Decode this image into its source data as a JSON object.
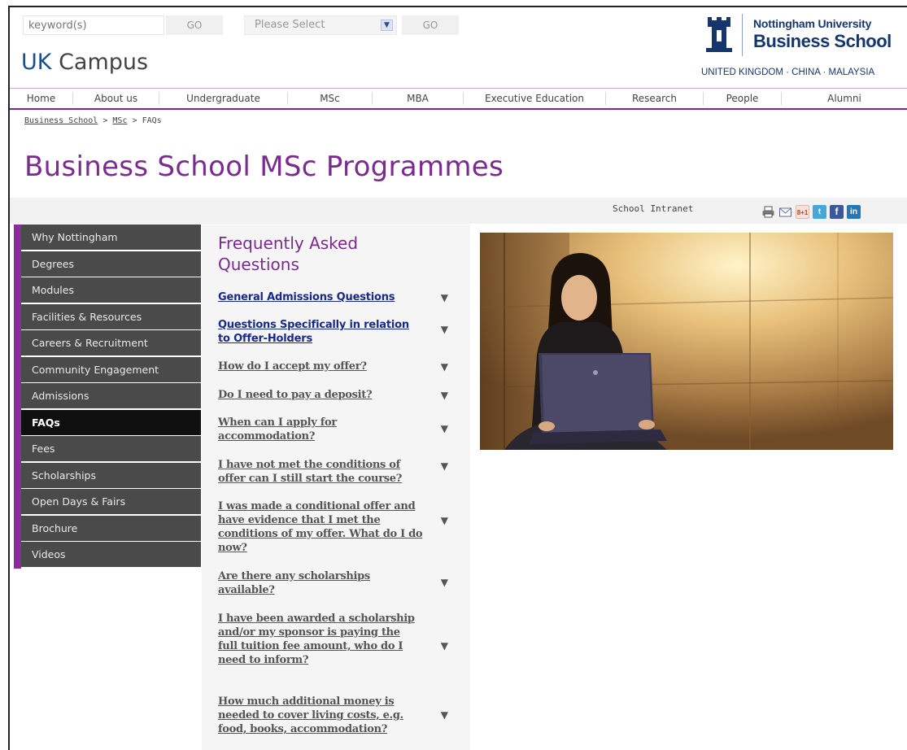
{
  "search": {
    "keyword_placeholder": "keyword(s)",
    "go_label": "GO",
    "select_value": "Please Select",
    "select_go_label": "GO"
  },
  "campus": {
    "prefix": "UK",
    "suffix": "Campus"
  },
  "logo": {
    "line1": "Nottingham University",
    "line2": "Business School",
    "line3": "UNITED KINGDOM · CHINA · MALAYSIA"
  },
  "topnav": [
    "Home",
    "About us",
    "Undergraduate",
    "MSc",
    "MBA",
    "Executive Education",
    "Research",
    "People",
    "Alumni"
  ],
  "breadcrumb": {
    "items": [
      "Business School",
      "MSc",
      "FAQs"
    ],
    "separator": ">"
  },
  "page_title": "Business School MSc Programmes",
  "toolbar": {
    "intranet_label": "School Intranet",
    "share_icons": [
      "print-icon",
      "email-icon",
      "google-plus-icon",
      "twitter-icon",
      "facebook-icon",
      "linkedin-icon"
    ],
    "google_plus_label": "8+1",
    "twitter_label": "t",
    "facebook_label": "f",
    "linkedin_label": "in"
  },
  "sidebar": [
    {
      "label": "Why Nottingham",
      "active": false
    },
    {
      "label": "Degrees",
      "active": false
    },
    {
      "label": "Modules",
      "active": false
    },
    {
      "label": "Facilities & Resources",
      "active": false
    },
    {
      "label": "Careers & Recruitment",
      "active": false
    },
    {
      "label": "Community Engagement",
      "active": false
    },
    {
      "label": "Admissions",
      "active": false
    },
    {
      "label": "FAQs",
      "active": true
    },
    {
      "label": "Fees",
      "active": false
    },
    {
      "label": "Scholarships",
      "active": false
    },
    {
      "label": "Open Days & Fairs",
      "active": false
    },
    {
      "label": "Brochure",
      "active": false
    },
    {
      "label": "Videos",
      "active": false
    }
  ],
  "faq": {
    "heading": "Frequently Asked Questions",
    "items": [
      {
        "question": "General Admissions Questions",
        "section": true
      },
      {
        "question": "Questions Specifically in relation to Offer-Holders",
        "section": true
      },
      {
        "question": "How do I accept my offer?",
        "section": false
      },
      {
        "question": "Do I need to pay a deposit?",
        "section": false
      },
      {
        "question": "When can I apply for accommodation?",
        "section": false
      },
      {
        "question": "I have not met the conditions of offer can I still start the course?",
        "section": false
      },
      {
        "question": "I was made a conditional offer and have evidence that I met the conditions of my offer. What do I do now?",
        "section": false
      },
      {
        "question": "Are there any scholarships available?",
        "section": false
      },
      {
        "question": "I have been awarded a scholarship and/or my sponsor is paying the full tuition fee amount, who do I need to inform?",
        "section": false
      },
      {
        "question": "How much additional money is needed to cover living costs, e.g. food, books, accommodation?",
        "section": false
      }
    ]
  },
  "colors": {
    "brand_purple": "#7b2a8f",
    "sidebar_bg": "#4a4a4a",
    "sidebar_active": "#0f0f0f",
    "logo_navy": "#15366d"
  }
}
